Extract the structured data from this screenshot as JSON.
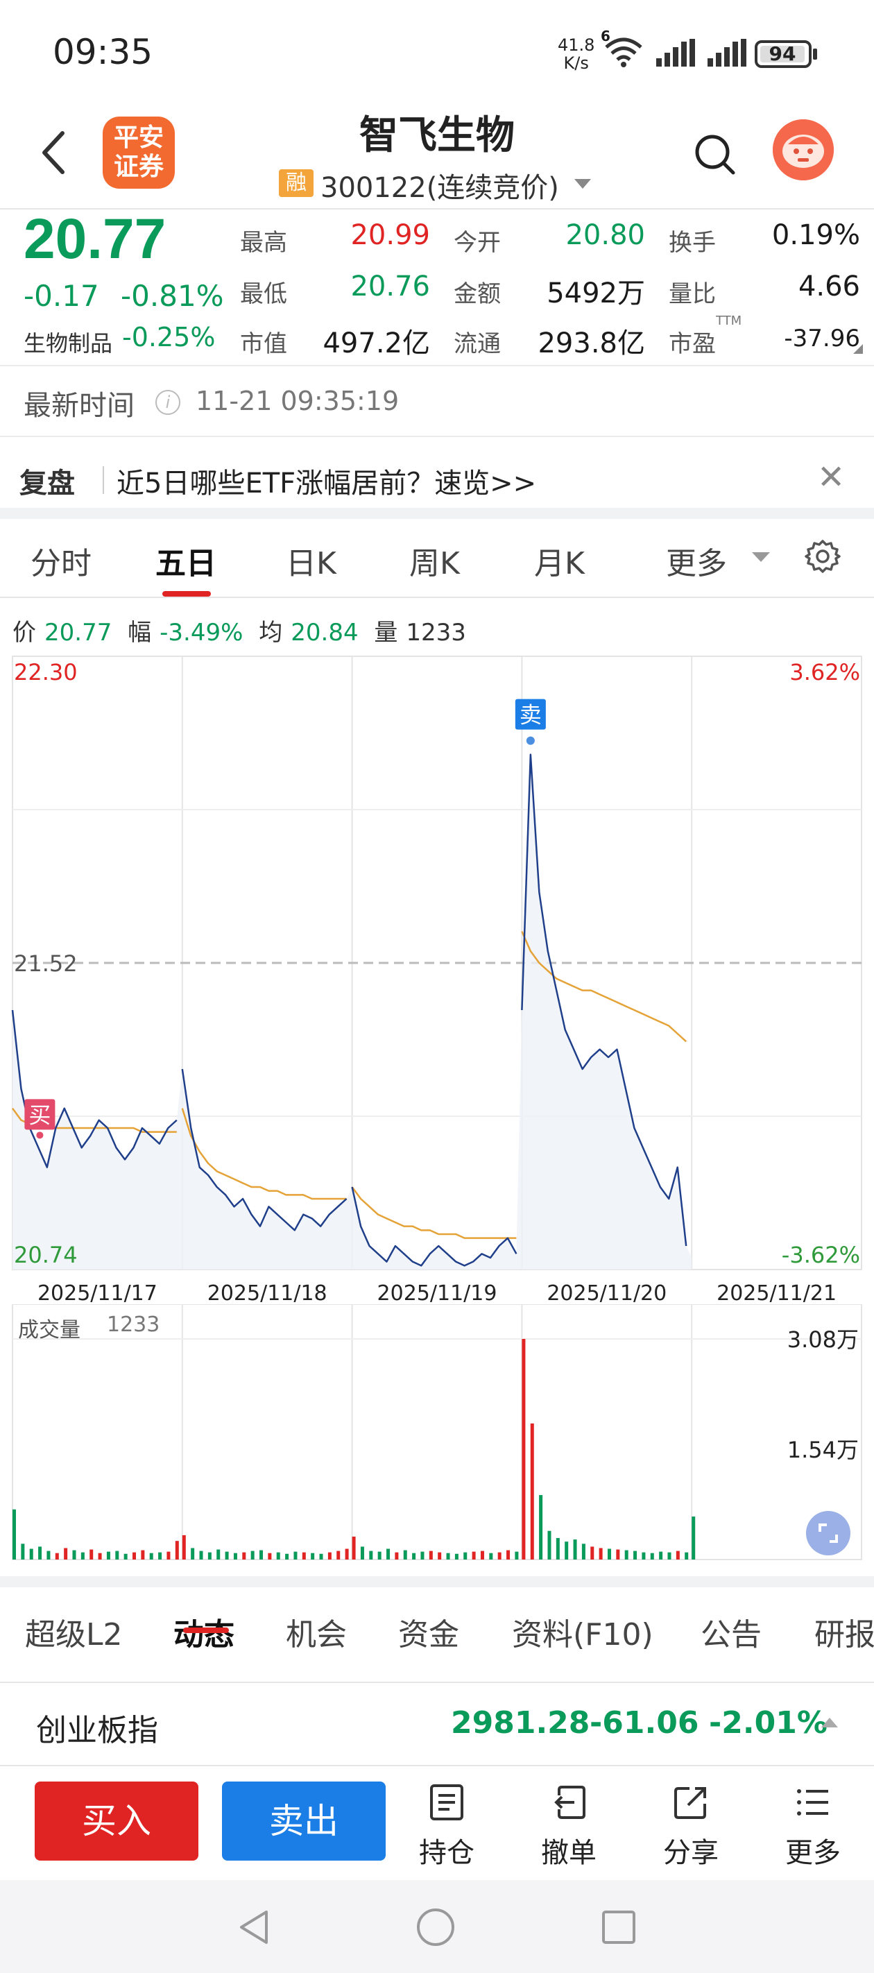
{
  "status_bar": {
    "time": "09:35",
    "net_speed_value": "41.8",
    "net_speed_unit": "K/s",
    "wifi_label": "6",
    "battery": "94"
  },
  "header": {
    "logo_text": "平安证券",
    "stock_name": "智飞生物",
    "margin_badge": "融",
    "stock_code": "300122(连续竞价)"
  },
  "quote": {
    "price": "20.77",
    "change": "-0.17",
    "change_pct": "-0.81%",
    "sector_name": "生物制品",
    "sector_pct": "-0.25%",
    "fields": [
      {
        "label": "最高",
        "value": "20.99",
        "color": "#e02424"
      },
      {
        "label": "今开",
        "value": "20.80",
        "color": "#0a9a5a"
      },
      {
        "label": "换手",
        "value": "0.19%",
        "color": "#1a1a1a"
      },
      {
        "label": "最低",
        "value": "20.76",
        "color": "#0a9a5a"
      },
      {
        "label": "金额",
        "value": "5492万",
        "color": "#1a1a1a"
      },
      {
        "label": "量比",
        "value": "4.66",
        "color": "#1a1a1a"
      },
      {
        "label": "市值",
        "value": "497.2亿",
        "color": "#1a1a1a"
      },
      {
        "label": "流通",
        "value": "293.8亿",
        "color": "#1a1a1a"
      },
      {
        "label": "市盈",
        "value": "-37.96",
        "color": "#1a1a1a"
      }
    ],
    "pe_superscript": "TTM"
  },
  "latest_time": {
    "label": "最新时间",
    "info_glyph": "i",
    "value": "11-21 09:35:19"
  },
  "replay": {
    "label": "复盘",
    "text": "近5日哪些ETF涨幅居前？速览>>"
  },
  "chart_tabs": [
    "分时",
    "五日",
    "日K",
    "周K",
    "月K",
    "更多"
  ],
  "active_chart_tab": "五日",
  "chart_info": {
    "price_label": "价",
    "price": "20.77",
    "range_label": "幅",
    "range": "-3.49%",
    "avg_label": "均",
    "avg": "20.84",
    "vol_label": "量",
    "vol": "1233"
  },
  "chart_data": {
    "type": "line",
    "x_categories": [
      "2025/11/17",
      "2025/11/18",
      "2025/11/19",
      "2025/11/20",
      "2025/11/21"
    ],
    "ylim": [
      20.74,
      22.3
    ],
    "y_top_label": "22.30",
    "y_mid_label": "21.52",
    "y_bottom_label": "20.74",
    "right_top_label": "3.62%",
    "right_bottom_label": "-3.62%",
    "reference_price": 21.52,
    "buy_marker": "买",
    "sell_marker": "卖",
    "series": [
      {
        "name": "价",
        "color": "#1f3f8a",
        "values": [
          21.4,
          21.2,
          21.1,
          21.05,
          21.0,
          21.1,
          21.15,
          21.1,
          21.05,
          21.08,
          21.12,
          21.1,
          21.05,
          21.02,
          21.05,
          21.1,
          21.08,
          21.06,
          21.1,
          21.12,
          21.25,
          21.1,
          21.0,
          20.98,
          20.95,
          20.93,
          20.9,
          20.92,
          20.88,
          20.85,
          20.9,
          20.88,
          20.86,
          20.84,
          20.88,
          20.87,
          20.85,
          20.88,
          20.9,
          20.92,
          20.95,
          20.85,
          20.8,
          20.78,
          20.76,
          20.8,
          20.78,
          20.76,
          20.75,
          20.78,
          20.8,
          20.78,
          20.76,
          20.75,
          20.76,
          20.78,
          20.77,
          20.8,
          20.82,
          20.78,
          21.4,
          22.05,
          21.7,
          21.55,
          21.45,
          21.35,
          21.3,
          21.25,
          21.28,
          21.3,
          21.28,
          21.3,
          21.2,
          21.1,
          21.05,
          21.0,
          20.95,
          20.92,
          21.0,
          20.8,
          20.77
        ]
      },
      {
        "name": "均",
        "color": "#e5a236",
        "values": [
          21.15,
          21.12,
          21.11,
          21.1,
          21.1,
          21.1,
          21.1,
          21.1,
          21.1,
          21.1,
          21.1,
          21.1,
          21.1,
          21.1,
          21.1,
          21.09,
          21.09,
          21.09,
          21.09,
          21.09,
          21.15,
          21.08,
          21.04,
          21.01,
          20.99,
          20.98,
          20.97,
          20.96,
          20.95,
          20.95,
          20.94,
          20.94,
          20.93,
          20.93,
          20.93,
          20.92,
          20.92,
          20.92,
          20.92,
          20.92,
          20.95,
          20.92,
          20.9,
          20.88,
          20.87,
          20.86,
          20.85,
          20.85,
          20.84,
          20.84,
          20.83,
          20.83,
          20.83,
          20.82,
          20.82,
          20.82,
          20.82,
          20.82,
          20.82,
          20.82,
          21.6,
          21.55,
          21.52,
          21.5,
          21.48,
          21.47,
          21.46,
          21.45,
          21.45,
          21.44,
          21.43,
          21.42,
          21.41,
          21.4,
          21.39,
          21.38,
          21.37,
          21.36,
          21.34,
          21.32,
          null
        ]
      }
    ],
    "volume": {
      "title": "成交量",
      "value": "1233",
      "top_label": "3.08万",
      "mid_label": "1.54万",
      "ylim": [
        0,
        30800
      ],
      "values": [
        7000,
        2200,
        1500,
        1800,
        1200,
        900,
        1600,
        1300,
        1000,
        1400,
        900,
        1100,
        1200,
        800,
        1000,
        1300,
        900,
        1000,
        1100,
        2600,
        3400,
        1600,
        1200,
        1000,
        1400,
        1100,
        900,
        1000,
        1200,
        1300,
        900,
        1000,
        800,
        1100,
        1000,
        900,
        800,
        1000,
        1200,
        1500,
        3200,
        1800,
        1200,
        1100,
        1500,
        1000,
        1300,
        900,
        1100,
        1200,
        1000,
        900,
        800,
        1000,
        1100,
        1200,
        900,
        1000,
        1300,
        1100,
        30800,
        19000,
        9000,
        4000,
        3000,
        2500,
        2800,
        2200,
        1800,
        1600,
        1500,
        1400,
        1300,
        1200,
        1000,
        900,
        1100,
        1000,
        1200,
        1000,
        6000
      ],
      "up_color": "#e02424",
      "down_color": "#0a9a5a"
    }
  },
  "info_tabs": [
    "超级L2",
    "动态",
    "机会",
    "资金",
    "资料(F10)",
    "公告",
    "研报"
  ],
  "active_info_tab": "动态",
  "index": {
    "name": "创业板指",
    "value": "2981.28",
    "change": "-61.06",
    "change_pct": "-2.01%"
  },
  "actions": {
    "buy": "买入",
    "sell": "卖出",
    "items": [
      {
        "label": "持仓",
        "icon": "holdings-icon"
      },
      {
        "label": "撤单",
        "icon": "cancel-order-icon"
      },
      {
        "label": "分享",
        "icon": "share-icon"
      },
      {
        "label": "更多",
        "icon": "menu-icon"
      }
    ]
  }
}
